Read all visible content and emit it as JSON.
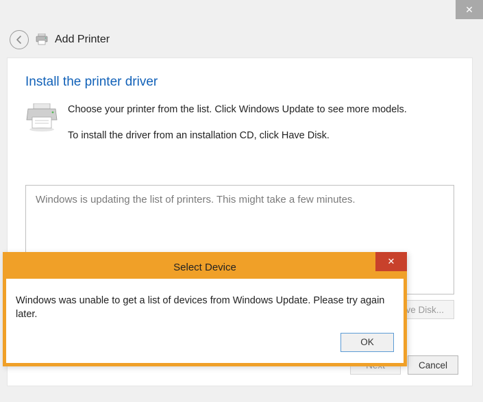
{
  "header": {
    "wizard_title": "Add Printer"
  },
  "panel": {
    "heading": "Install the printer driver",
    "line1": "Choose your printer from the list. Click Windows Update to see more models.",
    "line2": "To install the driver from an installation CD, click Have Disk."
  },
  "status": {
    "message": "Windows is updating the list of printers.  This might take a few minutes."
  },
  "buttons": {
    "have_disk": "Have Disk...",
    "next": "Next",
    "cancel": "Cancel"
  },
  "modal": {
    "title": "Select Device",
    "message": "Windows was unable to get a list of devices from Windows Update. Please try again later.",
    "ok": "OK"
  }
}
